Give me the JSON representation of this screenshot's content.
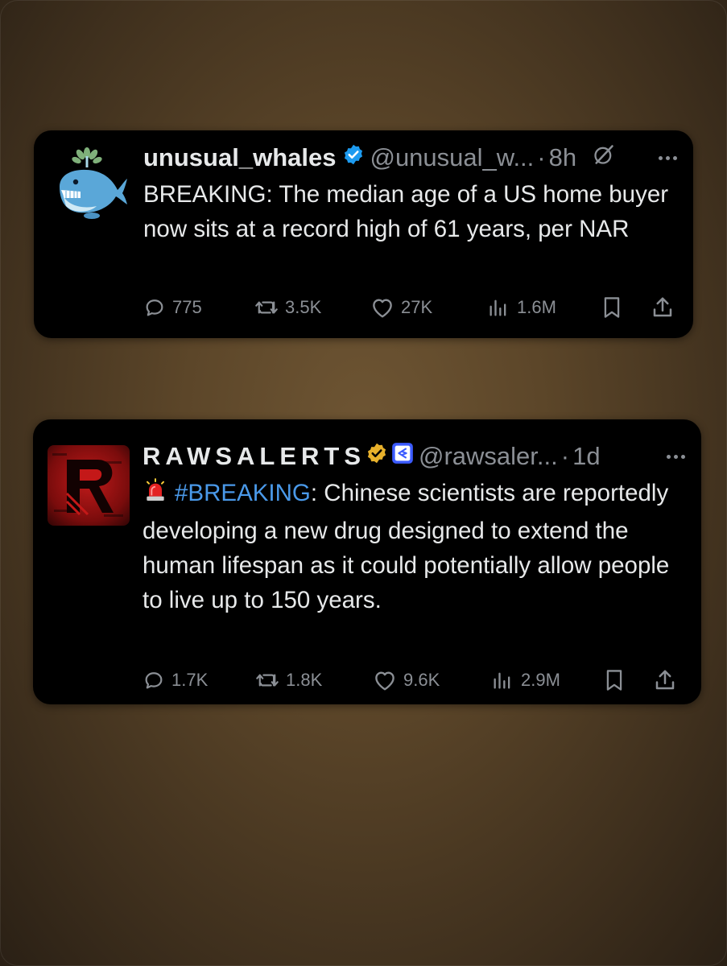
{
  "tweets": [
    {
      "display_name": "unusual_whales",
      "handle": "@unusual_w...",
      "separator": "·",
      "time": "8h",
      "text": "BREAKING: The median age of a US home buyer now sits at a record high of 61 years, per NAR",
      "stats": {
        "replies": "775",
        "reposts": "3.5K",
        "likes": "27K",
        "views": "1.6M"
      },
      "verified_color": "#1d9bf0",
      "avatar_icon": "whale-icon"
    },
    {
      "display_name": "RAWSALERTS",
      "handle": "@rawsaler...",
      "separator": "·",
      "time": "1d",
      "text_emoji": "siren-icon",
      "text_hashtag": "#BREAKING",
      "text_rest": ": Chinese scientists are reportedly developing a new drug designed to extend the human lifespan as it could potentially allow people to live up to 150 years.",
      "stats": {
        "replies": "1.7K",
        "reposts": "1.8K",
        "likes": "9.6K",
        "views": "2.9M"
      },
      "verified_color": "#e8b12b",
      "avatar_icon": "rawsalerts-logo"
    }
  ],
  "colors": {
    "link": "#4a99e9",
    "muted": "#8b8f95",
    "text": "#e7e9ea",
    "card": "#000000"
  }
}
